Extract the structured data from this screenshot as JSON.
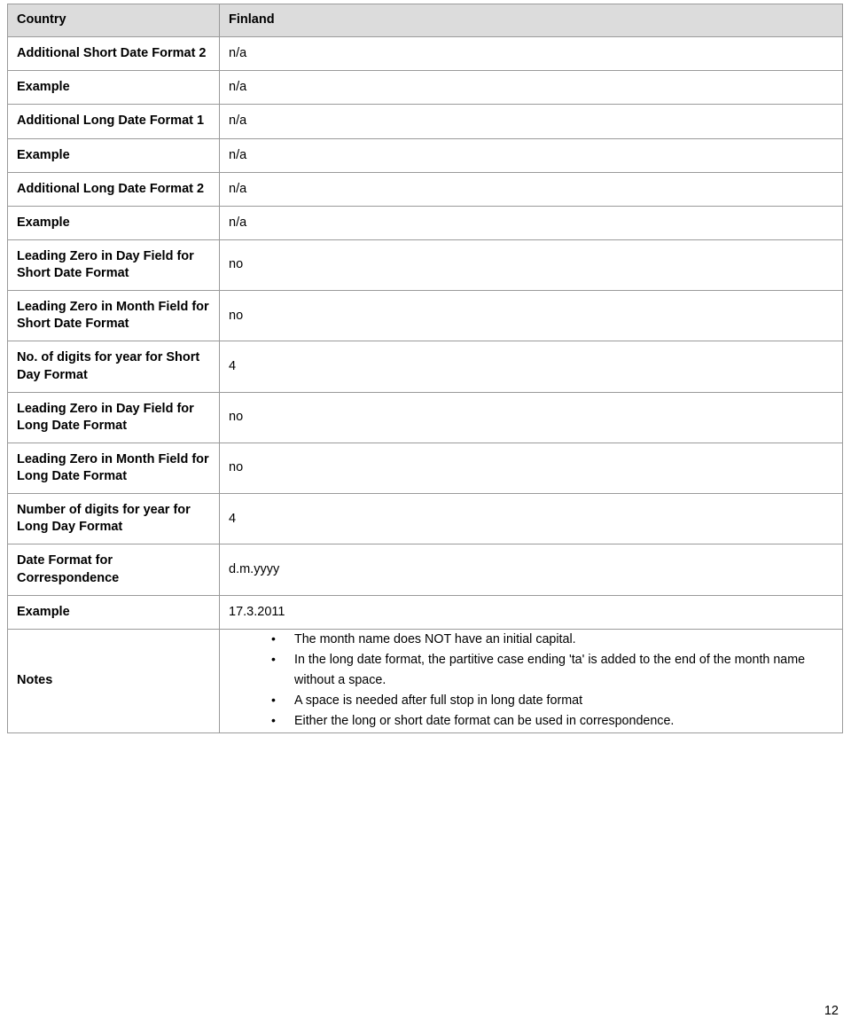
{
  "document": {
    "page_number": "12",
    "colors": {
      "header_background": "#dcdcdc",
      "border": "#9a9a9a",
      "text": "#000000",
      "page_background": "#ffffff"
    }
  },
  "table": {
    "header": {
      "label": "Country",
      "value": "Finland"
    },
    "rows": [
      {
        "label": "Additional Short Date Format 2",
        "value": "n/a"
      },
      {
        "label": "Example",
        "value": "n/a"
      },
      {
        "label": "Additional Long Date Format 1",
        "value": "n/a"
      },
      {
        "label": "Example",
        "value": "n/a"
      },
      {
        "label": "Additional Long Date Format 2",
        "value": "n/a"
      },
      {
        "label": "Example",
        "value": "n/a"
      },
      {
        "label": "Leading Zero in Day Field for Short Date Format",
        "value": "no"
      },
      {
        "label": "Leading Zero in Month Field for Short Date Format",
        "value": "no"
      },
      {
        "label": "No. of digits for year for Short Day Format",
        "value": "4"
      },
      {
        "label": "Leading Zero in Day Field for Long Date Format",
        "value": "no"
      },
      {
        "label": "Leading Zero in Month Field for Long Date Format",
        "value": "no"
      },
      {
        "label": "Number of digits for year for Long Day Format",
        "value": "4"
      },
      {
        "label": "Date Format for Correspondence",
        "value": "d.m.yyyy"
      },
      {
        "label": "Example",
        "value": "17.3.2011"
      }
    ],
    "notes": {
      "label": "Notes",
      "items": [
        "The month name does NOT have an initial capital.",
        "In the long date format, the partitive case ending 'ta' is added to the end of the month name without a space.",
        "A space is needed after full stop in long date format",
        "Either the long or short date format can be used in correspondence."
      ]
    }
  }
}
